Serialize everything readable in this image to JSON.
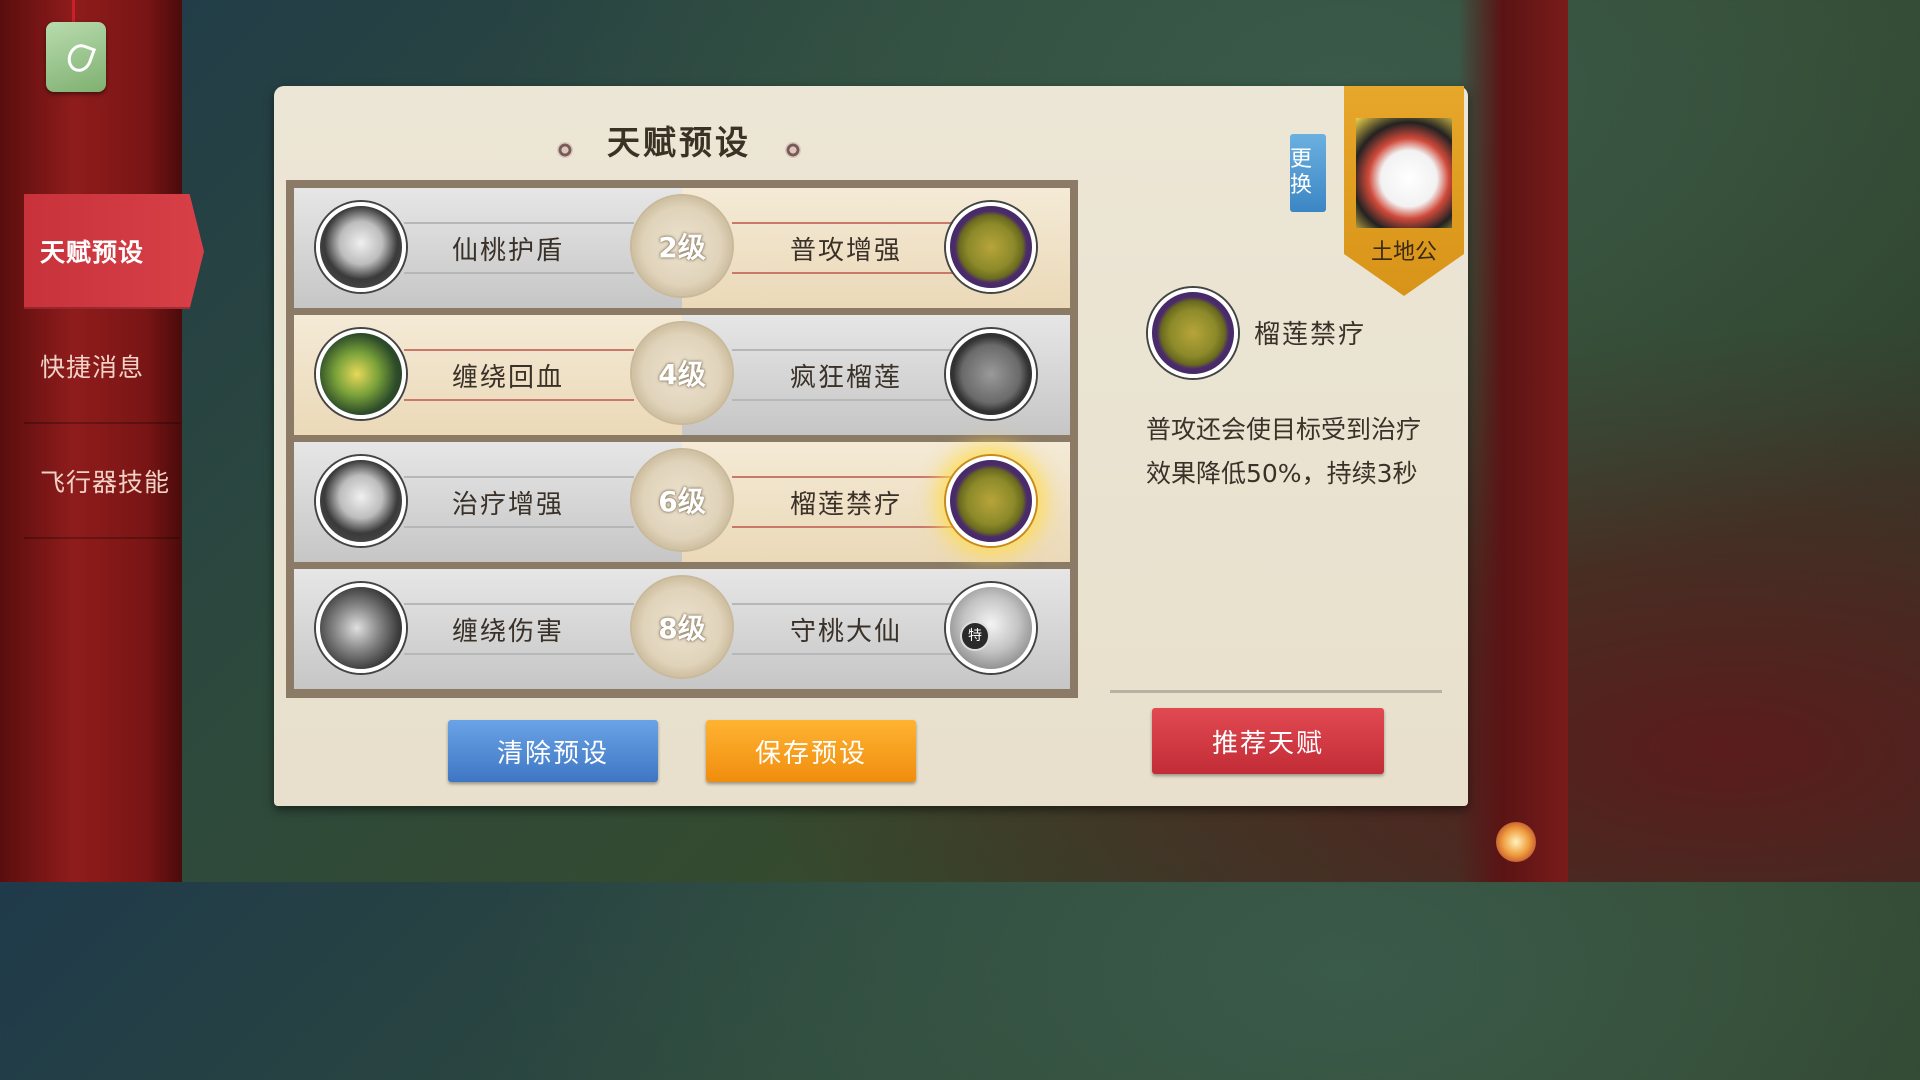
{
  "nav": {
    "items": [
      {
        "label": "天赋预设",
        "active": true
      },
      {
        "label": "快捷消息",
        "active": false
      },
      {
        "label": "飞行器技能",
        "active": false
      }
    ]
  },
  "panel": {
    "title": "天赋预设"
  },
  "talent_rows": [
    {
      "left": {
        "name": "仙桃护盾",
        "icon": "peach-icon",
        "selected": false
      },
      "level": "2级",
      "right": {
        "name": "普攻增强",
        "icon": "durian-icon",
        "selected": true
      }
    },
    {
      "left": {
        "name": "缠绕回血",
        "icon": "vine-icon",
        "selected": true
      },
      "level": "4级",
      "right": {
        "name": "疯狂榴莲",
        "icon": "durian-gray-icon",
        "selected": false
      }
    },
    {
      "left": {
        "name": "治疗增强",
        "icon": "peach-icon",
        "selected": false
      },
      "level": "6级",
      "right": {
        "name": "榴莲禁疗",
        "icon": "durian-icon",
        "selected": true,
        "highlighted": true
      }
    },
    {
      "left": {
        "name": "缠绕伤害",
        "icon": "vine-gray-icon",
        "selected": false
      },
      "level": "8级",
      "right": {
        "name": "守桃大仙",
        "icon": "cloud-icon",
        "selected": false,
        "badge": "特"
      }
    }
  ],
  "buttons": {
    "clear": "清除预设",
    "save": "保存预设",
    "recommend": "推荐天赋"
  },
  "character": {
    "change_label": "更换",
    "name": "土地公"
  },
  "detail": {
    "name": "榴莲禁疗",
    "description": "普攻还会使目标受到治疗效果降低50%，持续3秒"
  },
  "colors": {
    "selected_row": "#f4ead6",
    "unselected_row": "#d6d6d6",
    "accent_red": "#c8323a",
    "button_blue": "#4f86d4",
    "button_orange": "#f7a020",
    "button_red": "#d63a44"
  }
}
